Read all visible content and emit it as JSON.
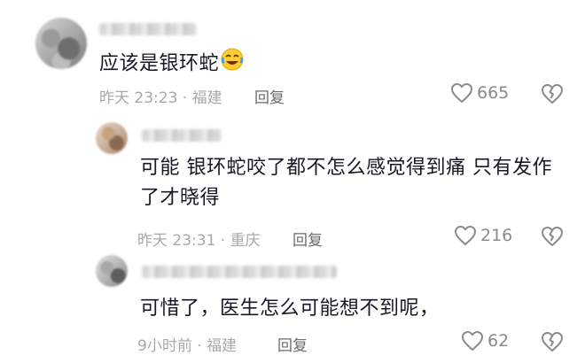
{
  "comments": [
    {
      "text": "应该是银环蛇",
      "emoji": "face-with-tears-of-joy",
      "meta": "昨天 23:23 · 福建",
      "reply_label": "回复",
      "likes": "665"
    },
    {
      "text": "可能  银环蛇咬了都不怎么感觉得到痛  只有发作了才晓得",
      "meta": "昨天 23:31 · 重庆",
      "reply_label": "回复",
      "likes": "216"
    },
    {
      "text": "可惜了，医生怎么可能想不到呢，",
      "meta": "9小时前 · 福建",
      "reply_label": "回复",
      "likes": "62"
    }
  ],
  "icons": {
    "like": "heart-outline-icon",
    "dislike": "broken-heart-icon"
  },
  "colors": {
    "text": "#161823",
    "meta": "#a8a8ab",
    "icon": "#8a8a8f"
  }
}
